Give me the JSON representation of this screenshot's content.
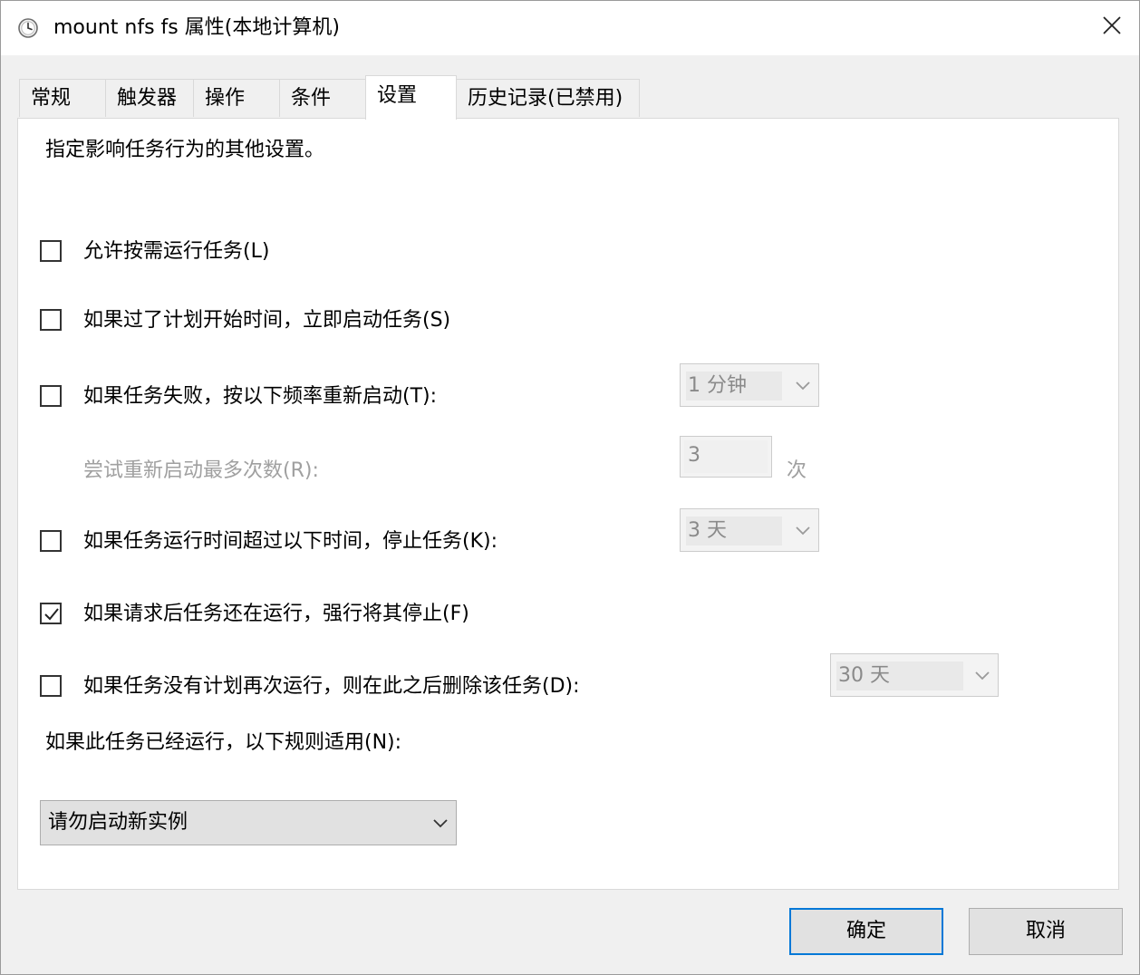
{
  "window": {
    "title": "mount nfs fs 属性(本地计算机)",
    "title_icon": "clock-icon",
    "close_icon": "close-icon"
  },
  "tabs": [
    {
      "label": "常规",
      "active": false
    },
    {
      "label": "触发器",
      "active": false
    },
    {
      "label": "操作",
      "active": false
    },
    {
      "label": "条件",
      "active": false
    },
    {
      "label": "设置",
      "active": true
    },
    {
      "label": "历史记录(已禁用)",
      "active": false
    }
  ],
  "settings": {
    "description": "指定影响任务行为的其他设置。",
    "allow_on_demand": {
      "label": "允许按需运行任务(L)",
      "checked": false
    },
    "run_if_missed": {
      "label": "如果过了计划开始时间，立即启动任务(S)",
      "checked": false
    },
    "restart_on_fail": {
      "label": "如果任务失败，按以下频率重新启动(T):",
      "checked": false,
      "interval": "1 分钟"
    },
    "restart_attempts": {
      "label": "尝试重新启动最多次数(R):",
      "value": "3",
      "unit": "次"
    },
    "stop_if_longer": {
      "label": "如果任务运行时间超过以下时间，停止任务(K):",
      "checked": false,
      "duration": "3 天"
    },
    "force_stop": {
      "label": "如果请求后任务还在运行，强行将其停止(F)",
      "checked": true
    },
    "delete_if_not_scheduled": {
      "label": "如果任务没有计划再次运行，则在此之后删除该任务(D):",
      "checked": false,
      "duration": "30 天"
    },
    "rule_label": "如果此任务已经运行，以下规则适用(N):",
    "rule_value": "请勿启动新实例"
  },
  "buttons": {
    "ok": "确定",
    "cancel": "取消"
  },
  "colors": {
    "accent": "#0078d7",
    "disabled_text": "#a0a0a0"
  }
}
